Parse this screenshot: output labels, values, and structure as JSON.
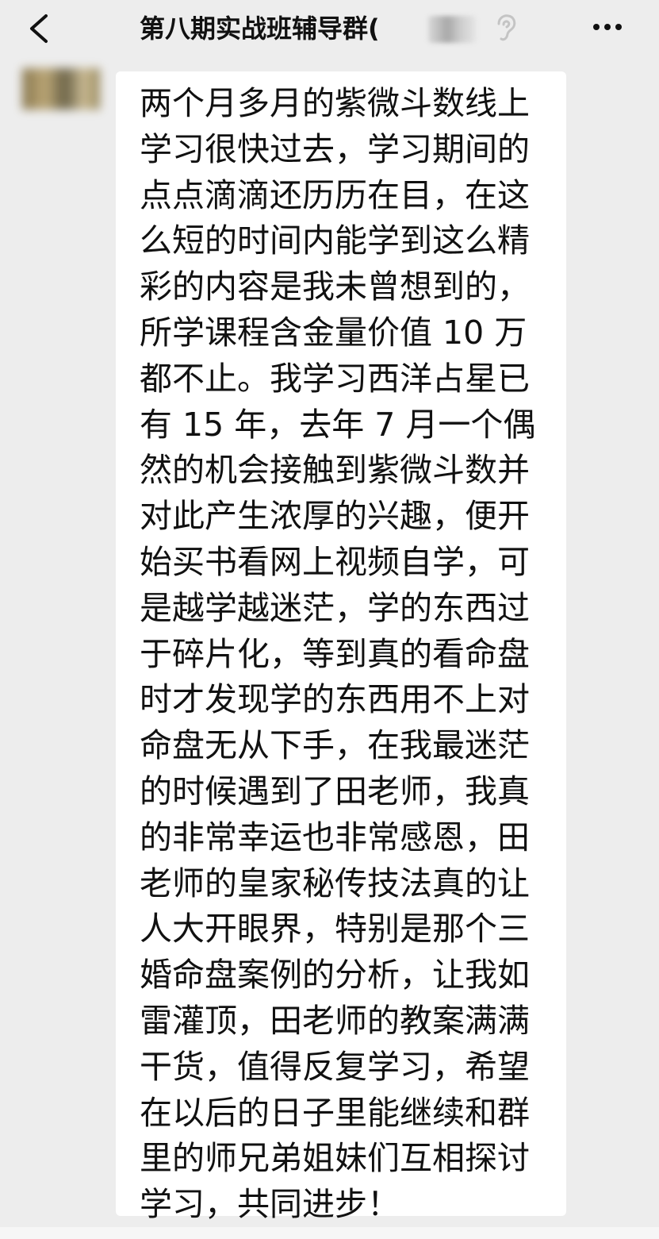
{
  "header": {
    "title": "第八期实战班辅导群(",
    "icons": {
      "back": "chevron-left-icon",
      "earpiece": "ear-icon",
      "more": "more-dots-icon"
    }
  },
  "message": {
    "lines": [
      "两个月多月的紫微斗数线上",
      "学习很快过去，学习期间的",
      "点点滴滴还历历在目，在这",
      "么短的时间内能学到这么精",
      "彩的内容是我未曾想到的，",
      "所学课程含金量价值 10 万",
      "都不止。我学习西洋占星已",
      "有 15 年，去年 7 月一个偶",
      "然的机会接触到紫微斗数并",
      "对此产生浓厚的兴趣，便开",
      "始买书看网上视频自学，可",
      "是越学越迷茫，学的东西过",
      "于碎片化，等到真的看命盘",
      "时才发现学的东西用不上对",
      "命盘无从下手，在我最迷茫",
      "的时候遇到了田老师，我真",
      "的非常幸运也非常感恩，田",
      "老师的皇家秘传技法真的让",
      "人大开眼界，特别是那个三",
      "婚命盘案例的分析，让我如",
      "雷灌顶，田老师的教案满满",
      "干货，值得反复学习，希望",
      "在以后的日子里能继续和群",
      "里的师兄弟姐妹们互相探讨",
      "学习，共同进步！"
    ]
  },
  "colors": {
    "background": "#ededed",
    "bubble": "#ffffff",
    "text": "#111111"
  }
}
